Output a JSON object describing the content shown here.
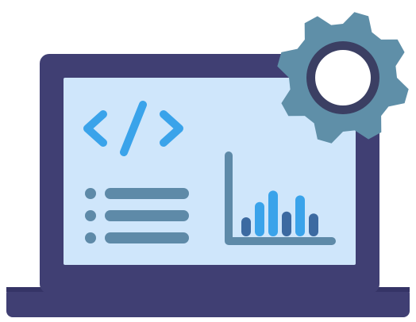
{
  "illustration": {
    "subject": "laptop-with-settings-gear",
    "icons": [
      "laptop-icon",
      "code-icon",
      "list-icon",
      "bar-chart-icon",
      "gear-icon"
    ],
    "mini_chart": {
      "type": "bar",
      "values": [
        0.2,
        0.36,
        0.48,
        0.26,
        0.43,
        0.24
      ],
      "colors": [
        "#3c6aa1",
        "#3aa3ea",
        "#3aa3ea",
        "#3c6aa1",
        "#3aa3ea",
        "#3c6aa1"
      ]
    },
    "list_rows": 3,
    "colors": {
      "laptop_body": "#403f73",
      "laptop_inner_shadow": "#353466",
      "screen": "#cfe6fb",
      "code_accent": "#3aa3ea",
      "list_lines": "#5e8aa8",
      "axis": "#5e8aa8",
      "bar_dark": "#3c6aa1",
      "bar_light": "#3aa3ea",
      "gear": "#5f8fa8",
      "gear_ring": "#3b3f63",
      "gear_center": "#ffffff"
    }
  }
}
